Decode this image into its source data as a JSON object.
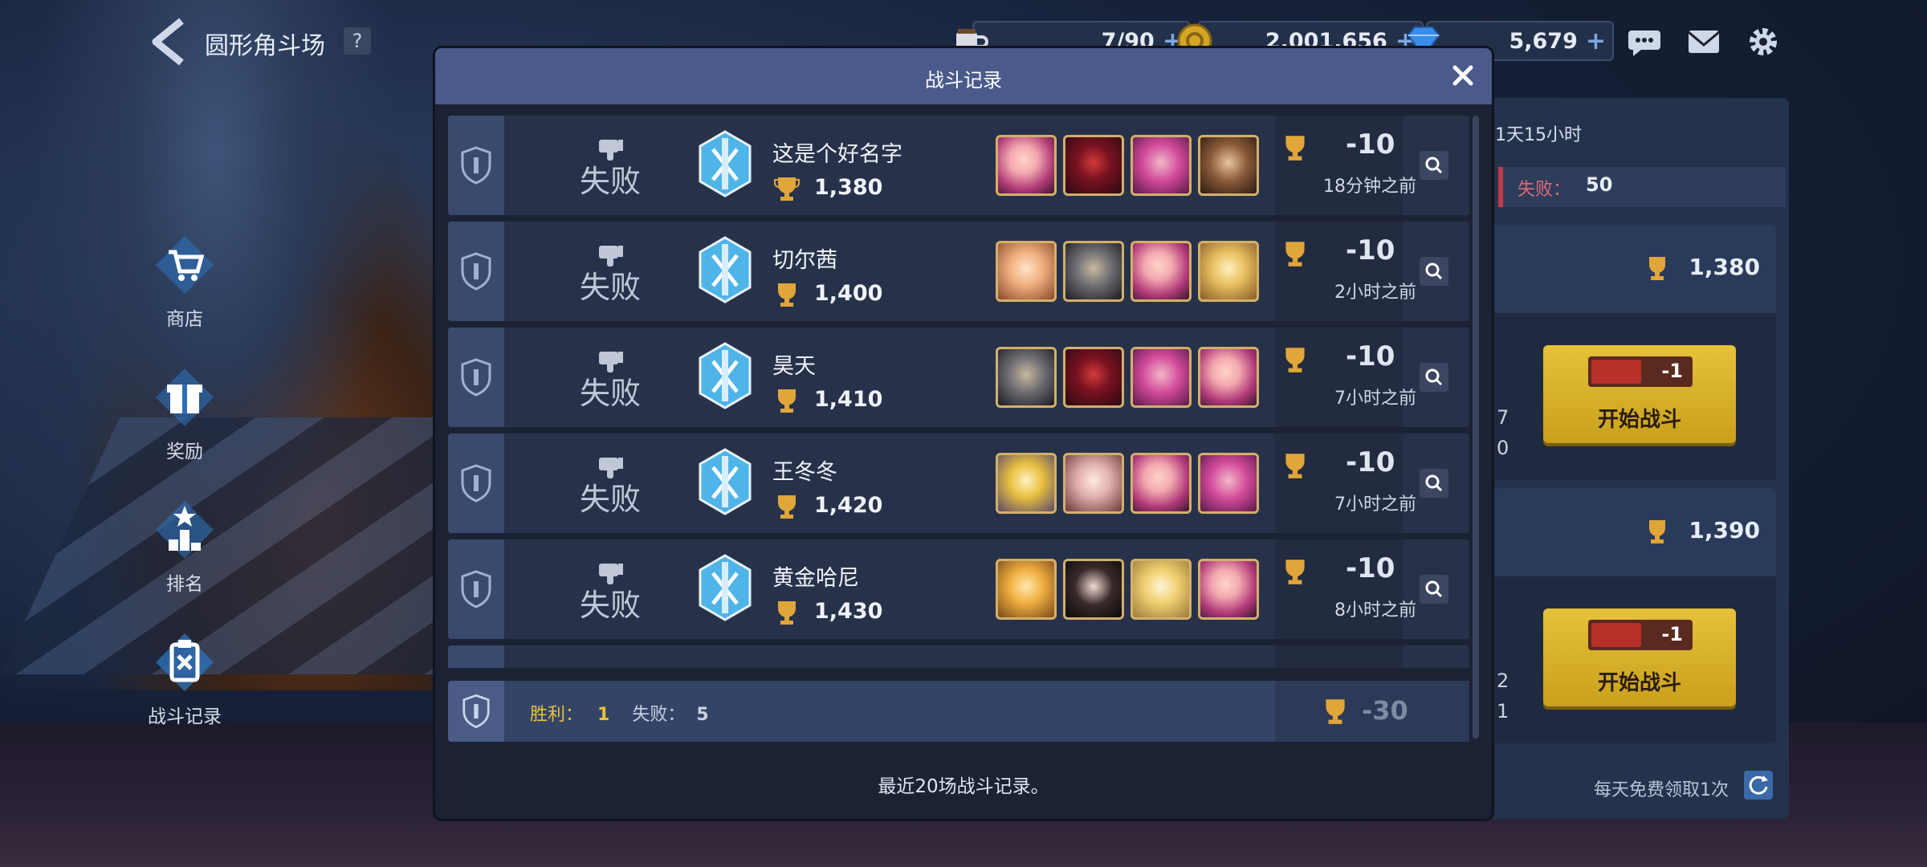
{
  "header": {
    "title": "圆形角斗场",
    "help": "?",
    "stamina": {
      "value": "7/90",
      "plus": "+"
    },
    "gold": {
      "value": "2,001,656",
      "plus": "+"
    },
    "gems": {
      "value": "5,679",
      "plus": "+"
    }
  },
  "sidebar": {
    "items": [
      {
        "label": "商店",
        "icon": "shopping-cart-icon"
      },
      {
        "label": "奖励",
        "icon": "gift-icon"
      },
      {
        "label": "排名",
        "icon": "podium-icon"
      },
      {
        "label": "战斗记录",
        "icon": "clipboard-icon"
      }
    ]
  },
  "right_panel": {
    "time_left": "1天15小时",
    "loss_label": "失败：",
    "loss_value": "50",
    "cards": [
      {
        "score": "1,380",
        "side_top": "7",
        "side_bottom": "0",
        "ticket": "-1",
        "button": "开始战斗"
      },
      {
        "score": "1,390",
        "side_top": "2",
        "side_bottom": "1",
        "ticket": "-1",
        "button": "开始战斗"
      }
    ],
    "free_claim": "每天免费领取1次"
  },
  "modal": {
    "title": "战斗记录",
    "records": [
      {
        "result": "失败",
        "name": "这是个好名字",
        "score": "1,380",
        "delta": "-10",
        "time": "18分钟之前"
      },
      {
        "result": "失败",
        "name": "切尔茜",
        "score": "1,400",
        "delta": "-10",
        "time": "2小时之前"
      },
      {
        "result": "失败",
        "name": "昊天",
        "score": "1,410",
        "delta": "-10",
        "time": "7小时之前"
      },
      {
        "result": "失败",
        "name": "王冬冬",
        "score": "1,420",
        "delta": "-10",
        "time": "7小时之前"
      },
      {
        "result": "失败",
        "name": "黄金哈尼",
        "score": "1,430",
        "delta": "-10",
        "time": "8小时之前"
      }
    ],
    "summary": {
      "win_label": "胜利：",
      "win_value": "1",
      "loss_label": "失败：",
      "loss_value": "5",
      "total": "-30"
    },
    "footnote": "最近20场战斗记录。"
  },
  "colors": {
    "accent_gold": "#e8c23a",
    "loss_red": "#c23a4d",
    "modal_header": "#4a5a8a",
    "button_yellow": "#e6c13a"
  }
}
